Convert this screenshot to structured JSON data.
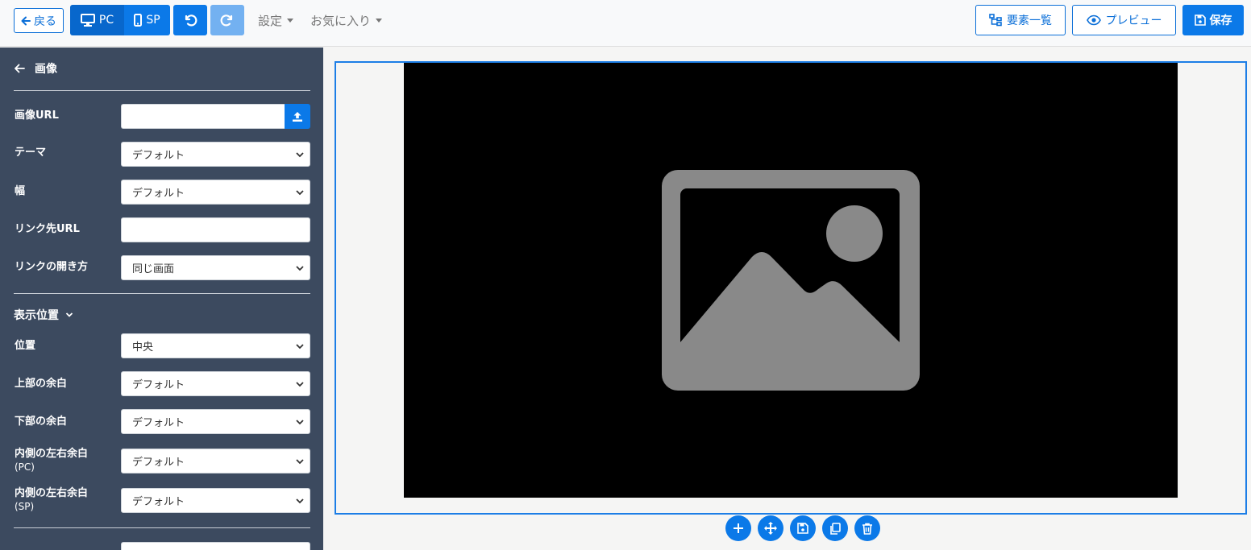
{
  "toolbar": {
    "back_label": "戻る",
    "device_pc_label": "PC",
    "device_sp_label": "SP",
    "settings_menu": "設定",
    "favorites_menu": "お気に入り",
    "elements_label": "要素一覧",
    "preview_label": "プレビュー",
    "save_label": "保存"
  },
  "sidebar": {
    "title": "画像",
    "fields": {
      "image_url_label": "画像URL",
      "image_url_value": "",
      "theme_label": "テーマ",
      "theme_value": "デフォルト",
      "width_label": "幅",
      "width_value": "デフォルト",
      "link_url_label": "リンク先URL",
      "link_url_value": "",
      "link_target_label": "リンクの開き方",
      "link_target_value": "同じ画面"
    },
    "display_section": "表示位置",
    "display_fields": {
      "position_label": "位置",
      "position_value": "中央",
      "top_margin_label": "上部の余白",
      "top_margin_value": "デフォルト",
      "bottom_margin_label": "下部の余白",
      "bottom_margin_value": "デフォルト",
      "inner_pc_label": "内側の左右余白",
      "inner_pc_sub": "(PC)",
      "inner_pc_value": "デフォルト",
      "inner_sp_label": "内側の左右余白",
      "inner_sp_sub": "(SP)",
      "inner_sp_value": "デフォルト"
    }
  },
  "colors": {
    "primary": "#0b79e8",
    "sidebar_bg": "#3c4a5f",
    "placeholder_icon": "#898989"
  },
  "icons": {
    "back": "arrow-left-icon",
    "pc": "desktop-icon",
    "sp": "mobile-icon",
    "undo": "undo-icon",
    "redo": "redo-icon",
    "elements": "sitemap-icon",
    "preview": "eye-icon",
    "save": "floppy-disk-icon",
    "upload": "upload-icon",
    "image_placeholder": "image-icon",
    "tools": [
      "plus-icon",
      "move-icon",
      "floppy-disk-icon",
      "copy-icon",
      "trash-icon"
    ]
  }
}
